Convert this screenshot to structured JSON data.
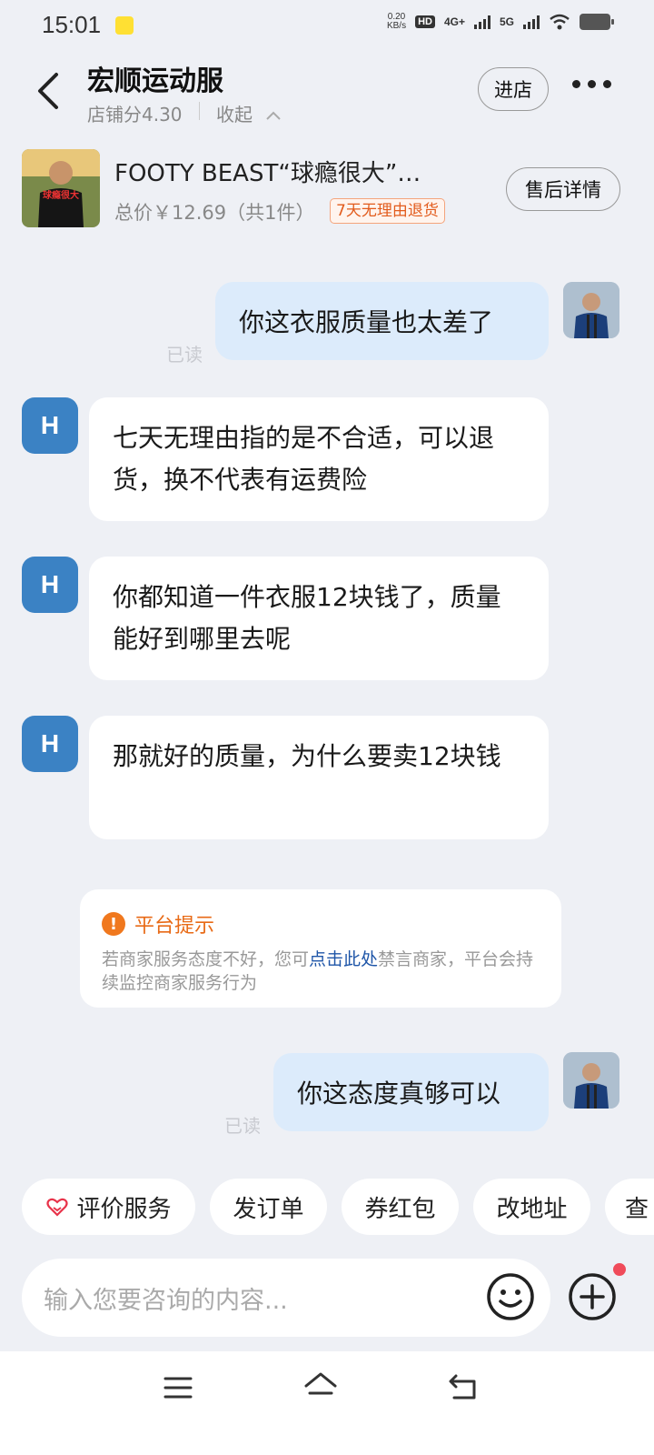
{
  "status_bar": {
    "time": "15:01",
    "net_speed_value": "0.20",
    "net_speed_unit": "KB/s",
    "hd": "HD",
    "net1": "4G+",
    "net2": "5G"
  },
  "header": {
    "shop_name": "宏顺运动服",
    "shop_score": "店铺分4.30",
    "collapse_label": "收起",
    "enter_store": "进店"
  },
  "product": {
    "thumb_text": "球瘾很大",
    "name": "FOOTY BEAST“球瘾很大”…",
    "price": "总价￥12.69（共1件）",
    "return_badge": "7天无理由退货",
    "after_sale_label": "售后详情"
  },
  "messages": {
    "m1": {
      "text": "你这衣服质量也太差了",
      "read": "已读"
    },
    "m2": {
      "avatar": "H",
      "text": "七天无理由指的是不合适，可以退货，换不代表有运费险"
    },
    "m3": {
      "avatar": "H",
      "text": "你都知道一件衣服12块钱了，质量能好到哪里去呢"
    },
    "m4": {
      "avatar": "H",
      "text": "那就好的质量，为什么要卖12块钱"
    },
    "m5": {
      "text": "你这态度真够可以",
      "read": "已读"
    }
  },
  "notice": {
    "title": "平台提示",
    "body_before": "若商家服务态度不好，您可",
    "link": "点击此处",
    "body_after": "禁言商家，平台会持续监控商家服务行为"
  },
  "quick_actions": [
    "评价服务",
    "发订单",
    "券红包",
    "改地址",
    "查"
  ],
  "input": {
    "placeholder": "输入您要咨询的内容..."
  },
  "colors": {
    "my_bubble": "#dcebfb",
    "merchant_avatar": "#3b82c4",
    "notice_orange": "#e86a16",
    "link_blue": "#1f56a8"
  }
}
